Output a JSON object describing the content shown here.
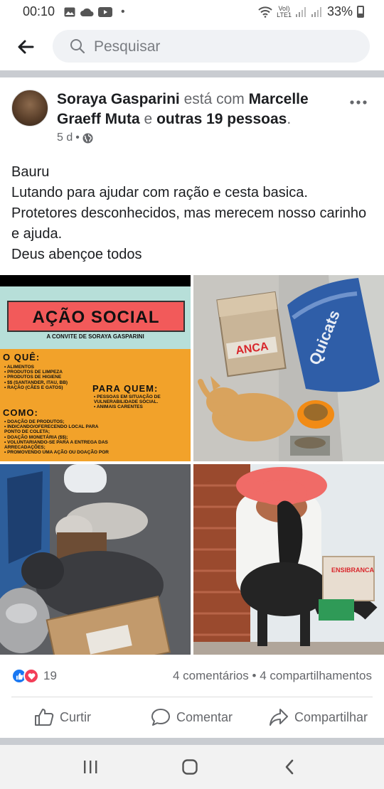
{
  "status_bar": {
    "time": "00:10",
    "network": "LTE1",
    "volte": "VoI)",
    "battery": "33%"
  },
  "search": {
    "placeholder": "Pesquisar"
  },
  "post": {
    "author": "Soraya Gasparini",
    "with_text": "está com",
    "tagged": "Marcelle Graeff Muta",
    "and_text": "e",
    "others": "outras 19 pessoas",
    "period": ".",
    "time_ago": "5 d",
    "dot": "•",
    "body_lines": [
      "Bauru",
      "Lutando para ajudar com ração e cesta basica.",
      "Protetores desconhecidos, mas merecem nosso carinho e ajuda.",
      "Deus abençoe todos"
    ]
  },
  "flyer": {
    "title": "AÇÃO SOCIAL",
    "subtitle": "A CONVITE DE SORAYA GASPARINI",
    "what_heading": "O QUÊ:",
    "what_items": [
      "• ALIMENTOS",
      "• PRODUTOS DE LIMPEZA",
      "• PRODUTOS DE HIGIENE",
      "• $$ (SANTANDER, ITAU, BB)",
      "• RAÇÃO (CÃES E GATOS)"
    ],
    "for_whom_heading": "PARA QUEM:",
    "for_whom_items": [
      "• PESSOAS EM SITUAÇÃO DE",
      "VULNERABILIDADE SOCIAL.",
      "• ANIMAIS CARENTES"
    ],
    "how_heading": "COMO:",
    "how_items": [
      "• DOAÇÃO DE PRODUTOS;",
      "• INDICANDO/OFERECENDO LOCAL PARA",
      "PONTO DE COLETA;",
      "• DOAÇÃO MONETÁRIA ($$);",
      "• VOLUNTARIANDO-SE PARA A ENTREGA DAS",
      "ARRECADAÇÕES;",
      "• PROMOVENDO UMA AÇÃO OU DOAÇÃO POR"
    ]
  },
  "photo_labels": {
    "box_brand": "ANCA",
    "bag_brand": "Quicats",
    "box_brand_2": "ENSIBRANCA"
  },
  "reactions": {
    "count": "19",
    "comments": "4 comentários",
    "separator": "•",
    "shares": "4 compartilhamentos"
  },
  "actions": {
    "like": "Curtir",
    "comment": "Comentar",
    "share": "Compartilhar"
  },
  "colors": {
    "fb_blue": "#1877f2",
    "love_red": "#f33e58",
    "flyer_red": "#f25a5a",
    "flyer_orange": "#f2a22a",
    "flyer_teal": "#b7dfd9"
  },
  "icons": {
    "back": "arrow-left-icon",
    "search": "search-icon",
    "globe": "globe-icon",
    "more": "more-horizontal-icon",
    "like": "thumbs-up-icon",
    "comment": "comment-bubble-icon",
    "share": "share-arrow-icon",
    "nav_recents": "recents-icon",
    "nav_home": "home-icon",
    "nav_back": "nav-back-icon"
  }
}
